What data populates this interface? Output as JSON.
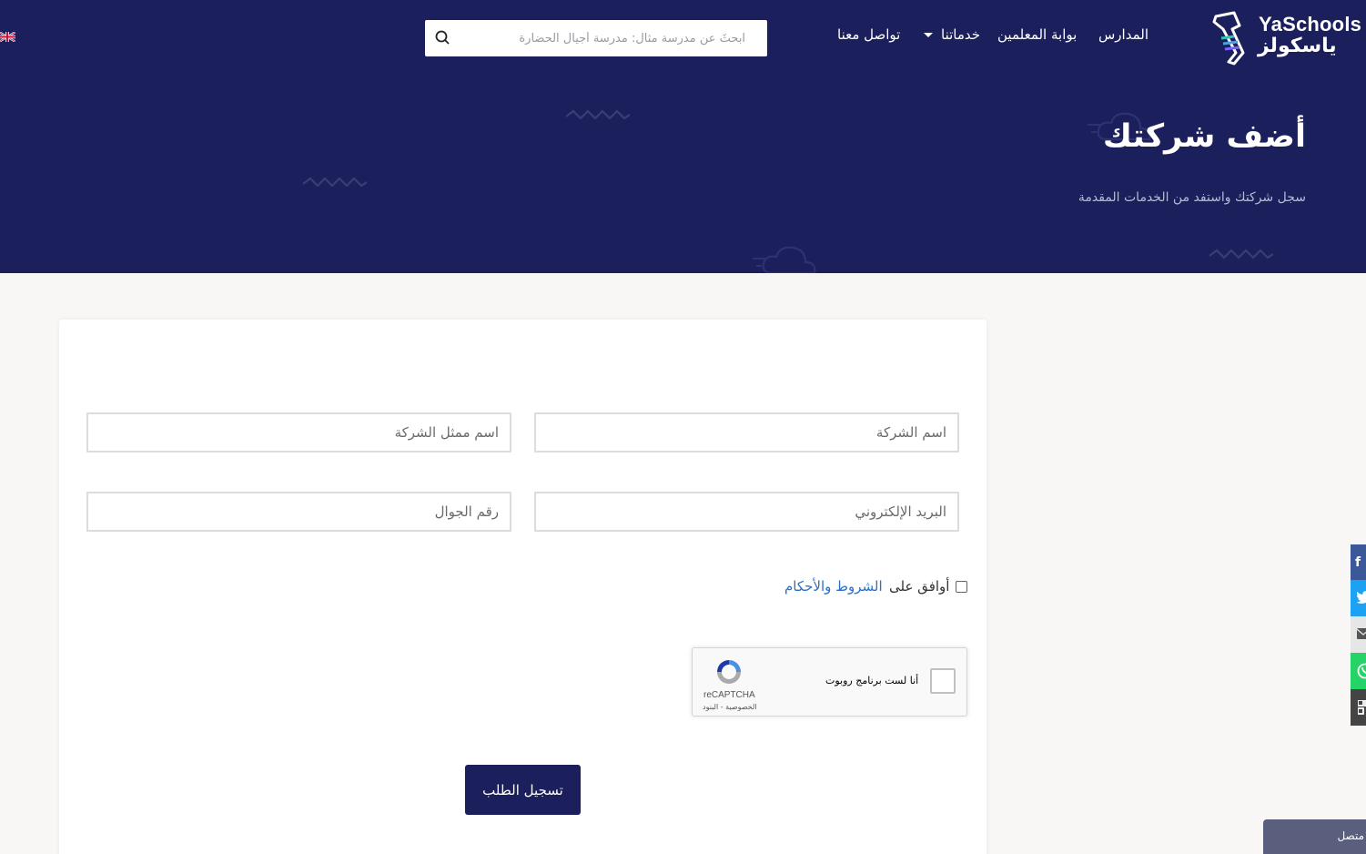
{
  "brand": {
    "name_en": "YaSchools",
    "name_ar": "ياسكولز"
  },
  "nav": {
    "schools": "المدارس",
    "teachers_portal": "بوابة المعلمين",
    "services": "خدماتنا",
    "contact": "تواصل معنا"
  },
  "search": {
    "placeholder": "ابحثَ عن مدرسة مثال: مدرسة أجيال الحضارة"
  },
  "hero": {
    "title": "أضف شركتك",
    "subtitle": "سجل شركتك واستفد من الخدمات المقدمة"
  },
  "form": {
    "company_name_placeholder": "اسم الشركة",
    "representative_placeholder": "اسم ممثل الشركة",
    "email_placeholder": "البريد الإلكتروني",
    "mobile_placeholder": "رقم الجوال",
    "agree_text": "أوافق على",
    "terms_link": "الشروط والأحكام",
    "submit_label": "تسجيل الطلب"
  },
  "recaptcha": {
    "label": "أنا لست برنامج روبوت",
    "brand": "reCAPTCHA",
    "privacy_terms": "الخصوصية - البنود"
  },
  "share": {
    "items": [
      "facebook-icon",
      "twitter-icon",
      "email-icon",
      "whatsapp-icon",
      "more-share-icon"
    ],
    "colors": [
      "#3b5998",
      "#1da1f2",
      "#848484",
      "#25d366",
      "#444444"
    ]
  },
  "chat": {
    "label": "متصل"
  },
  "colors": {
    "primary": "#1b1f5b",
    "link": "#2b6fc6",
    "page_bg": "#f8f7f5"
  }
}
